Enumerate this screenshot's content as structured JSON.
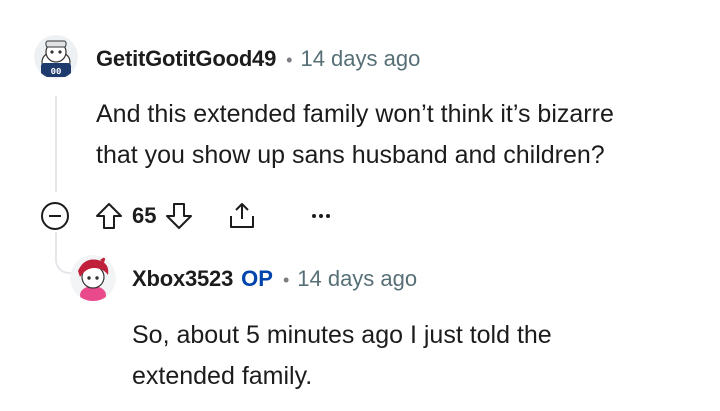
{
  "comment": {
    "username": "GetitGotitGood49",
    "separator": "•",
    "timestamp": "14 days ago",
    "body_lines": [
      "And this extended family won’t think it’s bizarre",
      "that you show up sans husband and children?"
    ],
    "votes": "65",
    "avatar_badge": "00",
    "icons": [
      "collapse-icon",
      "upvote-icon",
      "downvote-icon",
      "share-icon",
      "more-options-icon"
    ]
  },
  "reply": {
    "username": "Xbox3523",
    "op_badge": "OP",
    "separator": "•",
    "timestamp": "14 days ago",
    "body_lines": [
      "So, about 5 minutes ago I just told the",
      "extended family."
    ]
  },
  "colors": {
    "text": "#1c1c1c",
    "meta": "#576f76",
    "op": "#0045ac",
    "thread": "#e5e7eb",
    "avatar2_hair": "#c0203a",
    "avatar2_shirt": "#e84a8c"
  }
}
